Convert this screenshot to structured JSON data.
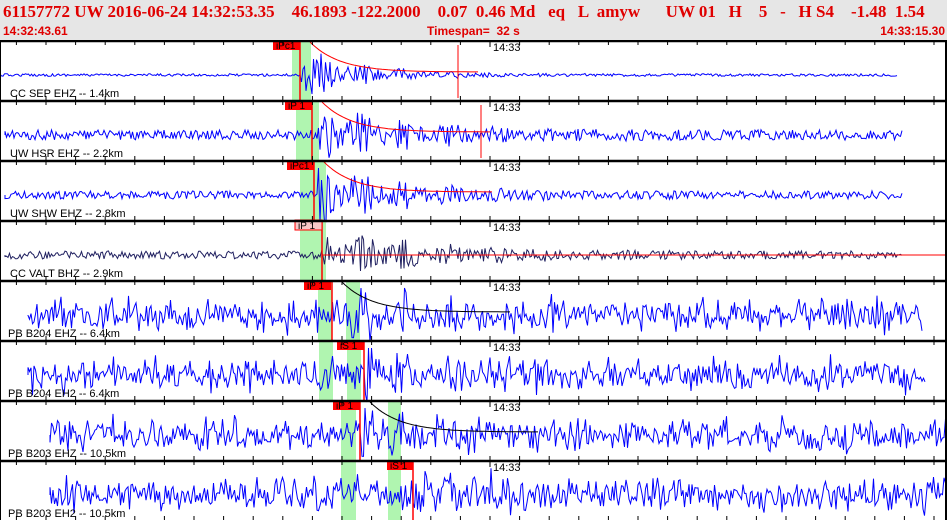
{
  "header": {
    "title": "61157772 UW 2016-06-24 14:32:53.35    46.1893 -122.2000    0.07  0.46 Md   eq   L  amyw      UW 01   H    5   -   H S4    -1.48  1.54",
    "start_time": "14:32:43.61",
    "timespan": "Timespan=  32 s",
    "end_time": "14:33:15.30"
  },
  "minute_label": "14:33",
  "colors": {
    "header_text": "#e00000",
    "trace": "#0000ff",
    "trace_bb": "#202060",
    "pick": "#ff0000",
    "window": "#b0f5b0"
  },
  "traces": [
    {
      "label": "CC SEP EHZ -- 1.4km",
      "pick": "iPc1"
    },
    {
      "label": "UW HSR EHZ -- 2.2km",
      "pick": "iP 1"
    },
    {
      "label": "UW SHW EHZ -- 2.8km",
      "pick": "iPc1"
    },
    {
      "label": "CC VALT BHZ -- 2.9km",
      "pick": "iP 1"
    },
    {
      "label": "PB B204 EHZ -- 6.4km",
      "pick": "iP 1"
    },
    {
      "label": "PB B204 EH2 -- 6.4km",
      "pick": "iS 1"
    },
    {
      "label": "PB B203 EHZ -- 10.5km",
      "pick": "iP 1"
    },
    {
      "label": "PB B203 EH2 -- 10.5km",
      "pick": "iS 1"
    }
  ]
}
